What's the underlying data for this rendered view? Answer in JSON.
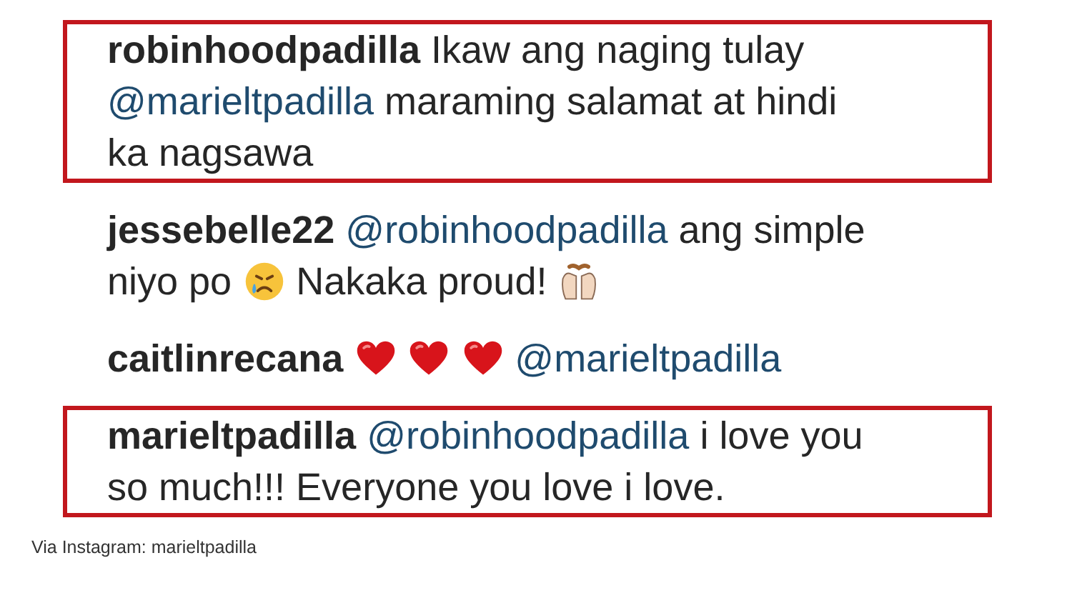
{
  "comments": [
    {
      "username": "robinhoodpadilla",
      "highlighted": true,
      "parts": [
        {
          "kind": "text",
          "text": "Ikaw ang naging tulay"
        },
        {
          "kind": "mention",
          "text": "@marieltpadilla"
        },
        {
          "kind": "text",
          "text": "maraming salamat at hindi ka nagsawa"
        }
      ]
    },
    {
      "username": "jessebelle22",
      "highlighted": false,
      "parts": [
        {
          "kind": "mention",
          "text": "@robinhoodpadilla"
        },
        {
          "kind": "text",
          "text": "ang simple niyo po"
        },
        {
          "kind": "sad_emoji"
        },
        {
          "kind": "text",
          "text": "Nakaka proud!"
        },
        {
          "kind": "hands_emoji"
        }
      ]
    },
    {
      "username": "caitlinrecana",
      "highlighted": false,
      "parts": [
        {
          "kind": "heart_emoji"
        },
        {
          "kind": "heart_emoji"
        },
        {
          "kind": "heart_emoji"
        },
        {
          "kind": "mention",
          "text": "@marieltpadilla"
        }
      ]
    },
    {
      "username": "marieltpadilla",
      "highlighted": true,
      "parts": [
        {
          "kind": "mention",
          "text": "@robinhoodpadilla"
        },
        {
          "kind": "text",
          "text": "i love you so much!!! Everyone you love i love."
        }
      ]
    }
  ],
  "caption": "Via Instagram: marieltpadilla"
}
